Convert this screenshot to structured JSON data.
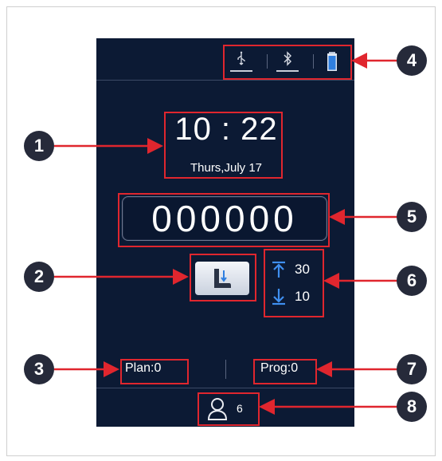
{
  "clock": {
    "time": "10 : 22",
    "date": "Thurs,July 17"
  },
  "counter": {
    "value": "000000"
  },
  "depth": {
    "up": "30",
    "down": "10"
  },
  "plan": {
    "label": "Plan:0"
  },
  "prog": {
    "label": "Prog:0"
  },
  "user": {
    "count": "6"
  },
  "status_icons": [
    "usb-icon",
    "bluetooth-icon",
    "battery-icon"
  ],
  "callouts": [
    "1",
    "2",
    "3",
    "4",
    "5",
    "6",
    "7",
    "8"
  ],
  "colors": {
    "screen_bg": "#0c1a34",
    "callout_red": "#e0262e",
    "battery_blue": "#2f7fe0",
    "marker_bg": "#262a3a"
  }
}
